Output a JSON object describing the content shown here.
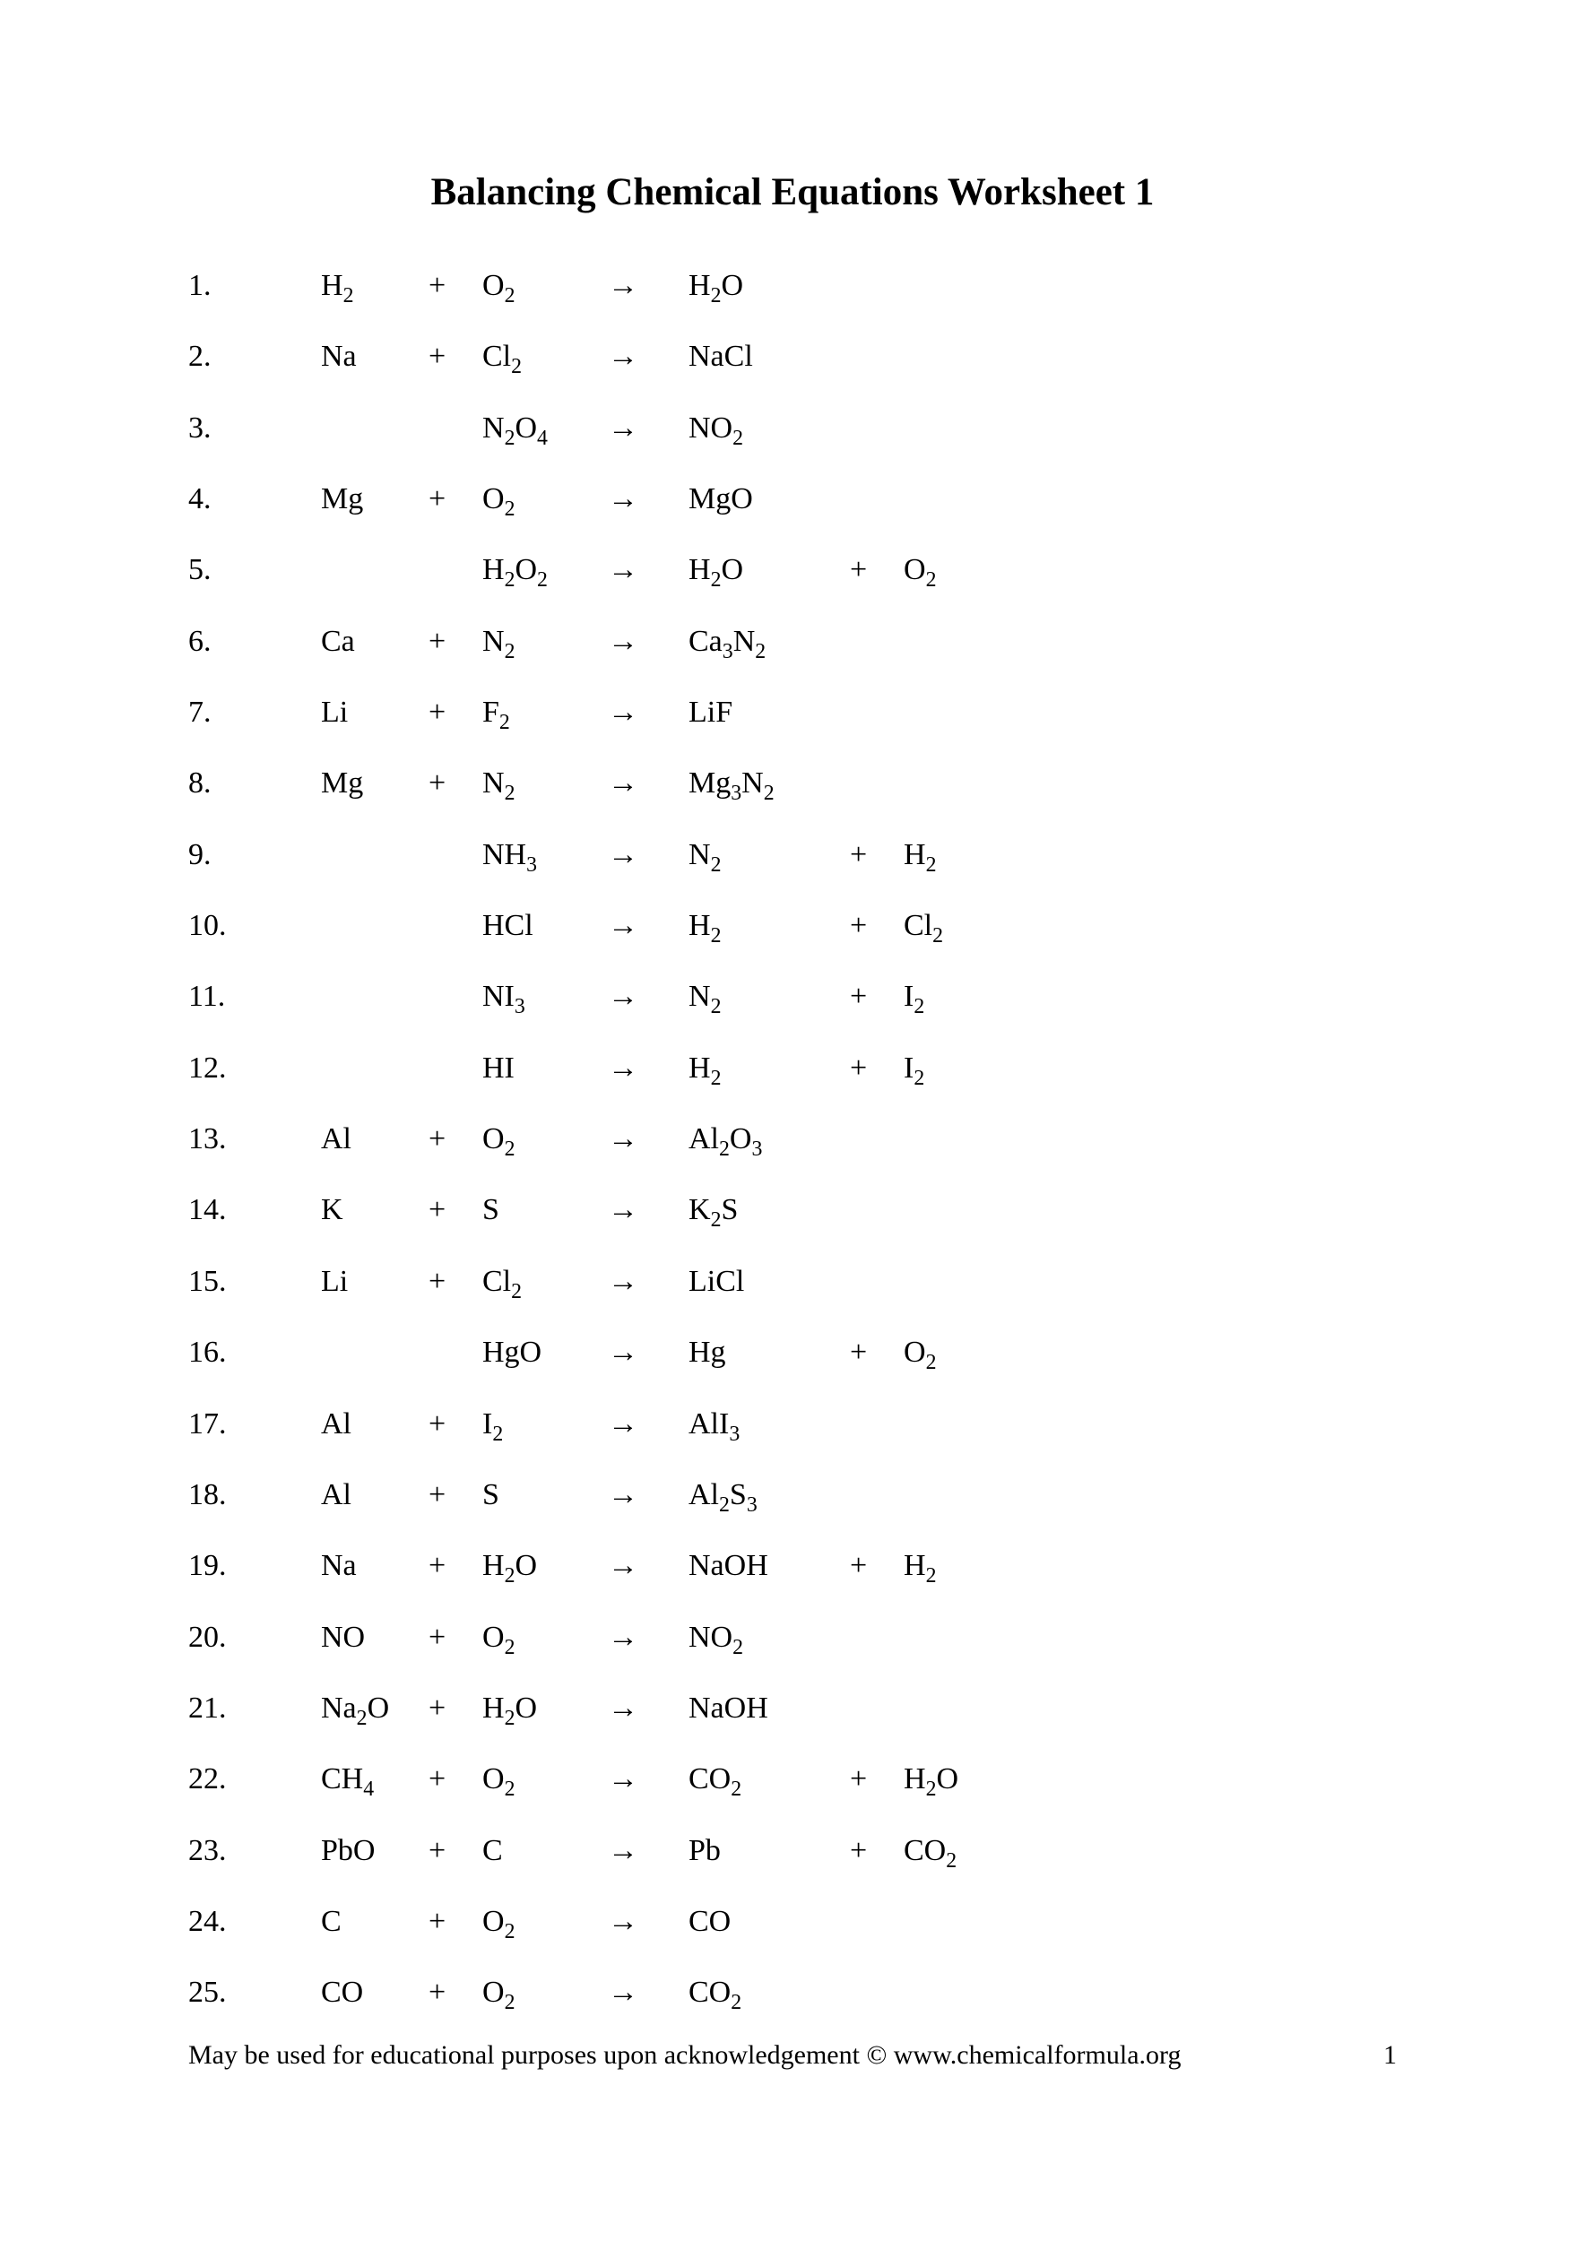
{
  "title": "Balancing Chemical Equations Worksheet 1",
  "arrow": "→",
  "plus": "+",
  "footer_text": "May be used for educational purposes upon acknowledgement © www.chemicalformula.org",
  "page_number": "1",
  "equations": [
    {
      "n": "1.",
      "r1": "H_2",
      "p1": "+",
      "r2": "O_2",
      "p": "H_2O",
      "p2": "",
      "p3": ""
    },
    {
      "n": "2.",
      "r1": "Na",
      "p1": "+",
      "r2": "Cl_2",
      "p": "NaCl",
      "p2": "",
      "p3": ""
    },
    {
      "n": "3.",
      "r1": "",
      "p1": "",
      "r2": "N_2O_4",
      "p": "NO_2",
      "p2": "",
      "p3": ""
    },
    {
      "n": "4.",
      "r1": "Mg",
      "p1": "+",
      "r2": "O_2",
      "p": "MgO",
      "p2": "",
      "p3": ""
    },
    {
      "n": "5.",
      "r1": "",
      "p1": "",
      "r2": "H_2O_2",
      "p": "H_2O",
      "p2": "+",
      "p3": "O_2"
    },
    {
      "n": "6.",
      "r1": "Ca",
      "p1": "+",
      "r2": "N_2",
      "p": "Ca_3N_2",
      "p2": "",
      "p3": ""
    },
    {
      "n": "7.",
      "r1": "Li",
      "p1": "+",
      "r2": "F_2",
      "p": "LiF",
      "p2": "",
      "p3": ""
    },
    {
      "n": "8.",
      "r1": "Mg",
      "p1": "+",
      "r2": "N_2",
      "p": "Mg_3N_2",
      "p2": "",
      "p3": ""
    },
    {
      "n": "9.",
      "r1": "",
      "p1": "",
      "r2": "NH_3",
      "p": "N_2",
      "p2": "+",
      "p3": "H_2"
    },
    {
      "n": "10.",
      "r1": "",
      "p1": "",
      "r2": "HCl",
      "p": "H_2",
      "p2": "+",
      "p3": "Cl_2"
    },
    {
      "n": "11.",
      "r1": "",
      "p1": "",
      "r2": "NI_3",
      "p": "N_2",
      "p2": "+",
      "p3": "I_2"
    },
    {
      "n": "12.",
      "r1": "",
      "p1": "",
      "r2": "HI",
      "p": "H_2",
      "p2": "+",
      "p3": "I_2"
    },
    {
      "n": "13.",
      "r1": "Al",
      "p1": "+",
      "r2": "O_2",
      "p": "Al_2O_3",
      "p2": "",
      "p3": ""
    },
    {
      "n": "14.",
      "r1": "K",
      "p1": "+",
      "r2": "S",
      "p": "K_2S",
      "p2": "",
      "p3": ""
    },
    {
      "n": "15.",
      "r1": "Li",
      "p1": "+",
      "r2": "Cl_2",
      "p": "LiCl",
      "p2": "",
      "p3": ""
    },
    {
      "n": "16.",
      "r1": "",
      "p1": "",
      "r2": "HgO",
      "p": "Hg",
      "p2": "+",
      "p3": "O_2"
    },
    {
      "n": "17.",
      "r1": "Al",
      "p1": "+",
      "r2": "I_2",
      "p": "AlI_3",
      "p2": "",
      "p3": ""
    },
    {
      "n": "18.",
      "r1": "Al",
      "p1": "+",
      "r2": "S",
      "p": "Al_2S_3",
      "p2": "",
      "p3": ""
    },
    {
      "n": "19.",
      "r1": "Na",
      "p1": "+",
      "r2": "H_2O",
      "p": "NaOH",
      "p2": "+",
      "p3": "H_2"
    },
    {
      "n": "20.",
      "r1": "NO",
      "p1": "+",
      "r2": "O_2",
      "p": "NO_2",
      "p2": "",
      "p3": ""
    },
    {
      "n": "21.",
      "r1": "Na_2O",
      "p1": "+",
      "r2": "H_2O",
      "p": "NaOH",
      "p2": "",
      "p3": ""
    },
    {
      "n": "22.",
      "r1": "CH_4",
      "p1": "+",
      "r2": "O_2",
      "p": "CO_2",
      "p2": "+",
      "p3": "H_2O"
    },
    {
      "n": "23.",
      "r1": "PbO",
      "p1": "+",
      "r2": "C",
      "p": "Pb",
      "p2": "+",
      "p3": "CO_2"
    },
    {
      "n": "24.",
      "r1": "C",
      "p1": "+",
      "r2": "O_2",
      "p": "CO",
      "p2": "",
      "p3": ""
    },
    {
      "n": "25.",
      "r1": "CO",
      "p1": "+",
      "r2": "O_2",
      "p": "CO_2",
      "p2": "",
      "p3": ""
    }
  ]
}
